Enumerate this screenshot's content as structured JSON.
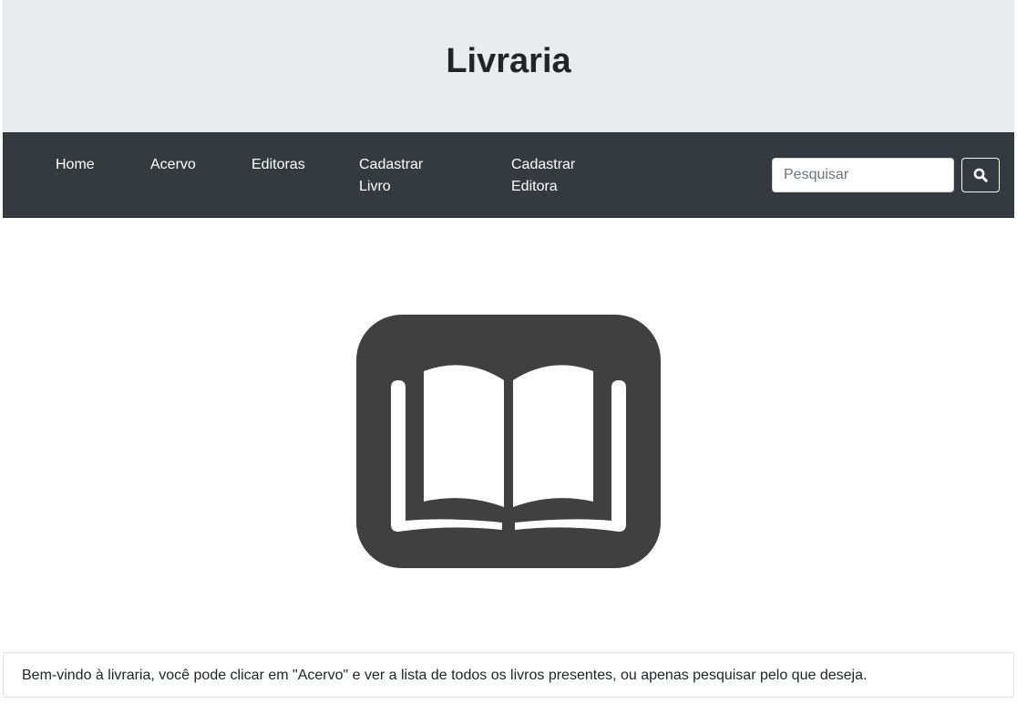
{
  "header": {
    "title": "Livraria"
  },
  "nav": {
    "items": [
      {
        "label": "Home"
      },
      {
        "label": "Acervo"
      },
      {
        "label": "Editoras"
      },
      {
        "label": "Cadastrar Livro"
      },
      {
        "label": "Cadastrar Editora"
      }
    ],
    "search": {
      "placeholder": "Pesquisar",
      "value": "",
      "button_icon": "search-icon"
    }
  },
  "main": {
    "logo_icon": "open-book-icon",
    "welcome_text": "Bem-vindo à livraria, você pode clicar em \"Acervo\" e ver a lista de todos os livros presentes, ou apenas pesquisar pelo que deseja."
  },
  "colors": {
    "header_bg": "#e9ecef",
    "navbar_bg": "#343a40",
    "logo_bg": "#404040",
    "text_dark": "#212529"
  }
}
